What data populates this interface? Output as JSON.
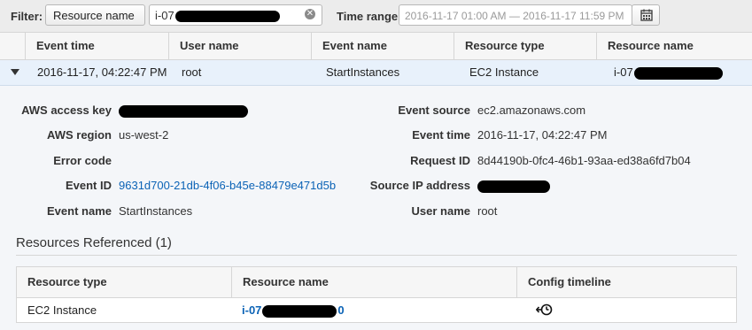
{
  "filter": {
    "label": "Filter:",
    "attribute": "Resource name",
    "value": "i-07",
    "time_label": "Time range:",
    "time_value": "2016-11-17 01:00 AM — 2016-11-17 11:59 PM"
  },
  "columns": [
    "Event time",
    "User name",
    "Event name",
    "Resource type",
    "Resource name"
  ],
  "event_row": {
    "event_time": "2016-11-17, 04:22:47 PM",
    "user_name": "root",
    "event_name": "StartInstances",
    "resource_type": "EC2 Instance",
    "resource_name": "i-07"
  },
  "details": {
    "access_key_label": "AWS access key",
    "access_key_value": "",
    "region_label": "AWS region",
    "region_value": "us-west-2",
    "error_code_label": "Error code",
    "error_code_value": "",
    "event_id_label": "Event ID",
    "event_id_value": "9631d700-21db-4f06-b45e-88479e471d5b",
    "event_name_label": "Event name",
    "event_name_value": "StartInstances",
    "event_source_label": "Event source",
    "event_source_value": "ec2.amazonaws.com",
    "event_time_label": "Event time",
    "event_time_value": "2016-11-17, 04:22:47 PM",
    "request_id_label": "Request ID",
    "request_id_value": "8d44190b-0fc4-46b1-93aa-ed38a6fd7b04",
    "source_ip_label": "Source IP address",
    "source_ip_value": "",
    "user_name_label": "User name",
    "user_name_value": "root"
  },
  "resources": {
    "title": "Resources Referenced (1)",
    "columns": [
      "Resource type",
      "Resource name",
      "Config timeline"
    ],
    "rows": [
      {
        "type": "EC2 Instance",
        "name": "i-07",
        "name_suffix": "0"
      }
    ]
  },
  "colors": {
    "link": "#0b63b6",
    "selected_row": "#e8f1fb",
    "detail_bg": "#f4f6f9",
    "redaction": "#000000"
  },
  "icons": [
    "clear-icon",
    "calendar-icon",
    "caret-down-icon",
    "config-timeline-icon"
  ]
}
